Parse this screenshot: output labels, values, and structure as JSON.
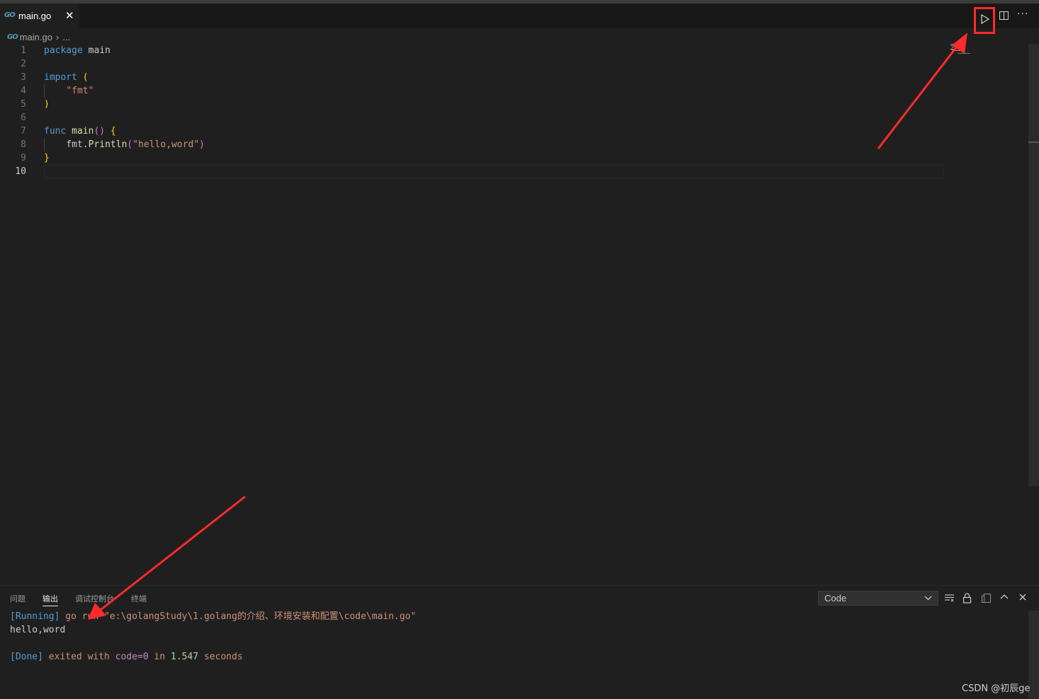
{
  "tab": {
    "icon": "go-file-icon",
    "logo_text": "GO",
    "label": "main.go",
    "close": "✕"
  },
  "toolbar": {
    "run_icon": "run-icon",
    "split_icon": "split-editor-icon",
    "more": "···"
  },
  "breadcrumb": {
    "file": "main.go",
    "sep": "›",
    "more": "..."
  },
  "editor": {
    "lines": [
      {
        "n": "1",
        "segments": [
          {
            "t": "package",
            "c": "kw"
          },
          {
            "t": " main",
            "c": "id"
          }
        ]
      },
      {
        "n": "2",
        "segments": []
      },
      {
        "n": "3",
        "segments": [
          {
            "t": "import",
            "c": "kw"
          },
          {
            "t": " ",
            "c": "id"
          },
          {
            "t": "(",
            "c": "br"
          }
        ]
      },
      {
        "n": "4",
        "segments": [
          {
            "t": "    ",
            "c": "id"
          },
          {
            "t": "\"fmt\"",
            "c": "str"
          }
        ]
      },
      {
        "n": "5",
        "segments": [
          {
            "t": ")",
            "c": "br"
          }
        ]
      },
      {
        "n": "6",
        "segments": []
      },
      {
        "n": "7",
        "segments": [
          {
            "t": "func",
            "c": "kw"
          },
          {
            "t": " ",
            "c": "id"
          },
          {
            "t": "main",
            "c": "fn"
          },
          {
            "t": "()",
            "c": "br2"
          },
          {
            "t": " ",
            "c": "id"
          },
          {
            "t": "{",
            "c": "br"
          }
        ]
      },
      {
        "n": "8",
        "segments": [
          {
            "t": "    ",
            "c": "id"
          },
          {
            "t": "fmt",
            "c": "id"
          },
          {
            "t": ".",
            "c": "id"
          },
          {
            "t": "Println",
            "c": "fn"
          },
          {
            "t": "(",
            "c": "br2"
          },
          {
            "t": "\"hello,word\"",
            "c": "str"
          },
          {
            "t": ")",
            "c": "br2"
          }
        ]
      },
      {
        "n": "9",
        "segments": [
          {
            "t": "}",
            "c": "br"
          }
        ]
      },
      {
        "n": "10",
        "segments": [],
        "active": true
      }
    ]
  },
  "panel": {
    "tabs": [
      "问题",
      "输出",
      "调试控制台",
      "终端"
    ],
    "active_tab": "输出",
    "channel": "Code",
    "icons": [
      "clear-output-icon",
      "lock-icon",
      "copy-icon",
      "maximize-icon",
      "close-icon"
    ],
    "output": [
      [
        {
          "t": "[Running]",
          "c": "o-blue"
        },
        {
          "t": " go run ",
          "c": "o-orange"
        },
        {
          "t": "\"e:\\golangStudy\\1.golang的介绍、环境安装和配置\\code\\main.go\"",
          "c": "o-orange"
        }
      ],
      [
        {
          "t": "hello,word",
          "c": ""
        }
      ],
      [],
      [
        {
          "t": "[Done]",
          "c": "o-blue"
        },
        {
          "t": " exited with ",
          "c": "o-orange"
        },
        {
          "t": "code=0",
          "c": "o-purple"
        },
        {
          "t": " in ",
          "c": "o-orange"
        },
        {
          "t": "1.547",
          "c": "o-green"
        },
        {
          "t": " seconds",
          "c": "o-orange"
        }
      ]
    ]
  },
  "watermark": "CSDN @初辰ge",
  "colors": {
    "annotation_red": "#ff2a2a",
    "go_blue": "#519aba"
  }
}
